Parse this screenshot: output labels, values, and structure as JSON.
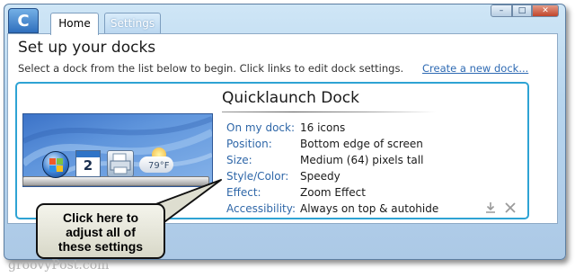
{
  "window": {
    "app_icon_glyph": "C",
    "controls": {
      "minimize": "–",
      "maximize": "□",
      "close": "✕"
    }
  },
  "tabs": [
    {
      "label": "Home",
      "selected": true
    },
    {
      "label": "Settings",
      "selected": false
    }
  ],
  "main": {
    "title": "Set up your docks",
    "intro": "Select a dock from the list below to begin. Click links to edit dock settings.",
    "create_link": "Create a new dock..."
  },
  "dock": {
    "name": "Quicklaunch Dock",
    "preview": {
      "calendar_day": "2",
      "weather_temp": "79°F",
      "icons": [
        "windows-start-icon",
        "calendar-icon",
        "printer-icon",
        "weather-icon"
      ]
    },
    "properties": [
      {
        "label": "On my dock:",
        "value": "16 icons"
      },
      {
        "label": "Position:",
        "value": "Bottom edge of screen"
      },
      {
        "label": "Size:",
        "value": "Medium (64) pixels tall"
      },
      {
        "label": "Style/Color:",
        "value": "Speedy"
      },
      {
        "label": "Effect:",
        "value": "Zoom Effect"
      },
      {
        "label": "Accessibility:",
        "value": "Always on top & autohide"
      }
    ],
    "action_icons": [
      "download-icon",
      "delete-icon"
    ]
  },
  "callout": {
    "lines": [
      "Click here to",
      "adjust all of",
      "these settings"
    ]
  },
  "watermark": "groovyPost.com",
  "colors": {
    "accent_border": "#2ea3d4",
    "link": "#2e6ab3",
    "label": "#2f67a8"
  }
}
